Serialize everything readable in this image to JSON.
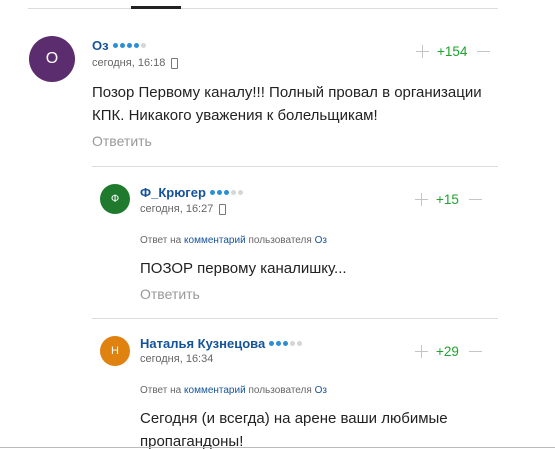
{
  "comments": [
    {
      "avatar_letter": "О",
      "avatar_color": "#5b2d6e",
      "author": "Оз",
      "time": "сегодня, 16:18",
      "rating": "+154",
      "text_line1": "Позор Первому каналу!!! Полный провал в организации",
      "text_line2": "КПК. Никакого уважения к болельщикам!",
      "reply_label": "Ответить"
    },
    {
      "avatar_letter": "Ф",
      "avatar_color": "#1f7a2e",
      "author": "Ф_Крюгер",
      "time": "сегодня, 16:27",
      "rating": "+15",
      "reply_prefix": "Ответ на",
      "reply_link": "комментарий",
      "reply_mid": "пользователя",
      "reply_user": "Оз",
      "text_line1": "ПОЗОР первому каналишку...",
      "reply_label": "Ответить"
    },
    {
      "avatar_letter": "Н",
      "avatar_color": "#e0820f",
      "author": "Наталья Кузнецова",
      "time": "сегодня, 16:34",
      "rating": "+29",
      "reply_prefix": "Ответ на",
      "reply_link": "комментарий",
      "reply_mid": "пользователя",
      "reply_user": "Оз",
      "text_line1": "Сегодня (и всегда) на арене ваши любимые",
      "text_line2": "пропагандоны!"
    }
  ],
  "colors": {
    "author_link": "#14539a",
    "rating_positive": "#1ea32d",
    "dot_active": "#2b8fd6",
    "dot_inactive": "#d6d6d6"
  }
}
